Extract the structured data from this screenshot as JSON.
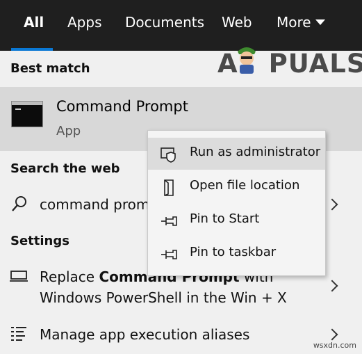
{
  "tabs": [
    {
      "label": "All",
      "active": true
    },
    {
      "label": "Apps"
    },
    {
      "label": "Documents"
    },
    {
      "label": "Web"
    },
    {
      "label": "More"
    }
  ],
  "best_match": {
    "section_title": "Best match",
    "title": "Command Prompt",
    "subtitle": "App"
  },
  "search_web": {
    "section_title": "Search the web",
    "query": "command prom"
  },
  "settings": {
    "section_title": "Settings",
    "item1_part1": "Replace ",
    "item1_bold": "Command Prompt",
    "item1_part2": " with",
    "item1_line2": "Windows PowerShell in the Win + X",
    "item2": "Manage app execution aliases"
  },
  "context_menu": {
    "items": [
      {
        "label": "Run as administrator",
        "icon": "shield-icon",
        "highlighted": true
      },
      {
        "label": "Open file location",
        "icon": "file-location-icon"
      },
      {
        "label": "Pin to Start",
        "icon": "pin-icon"
      },
      {
        "label": "Pin to taskbar",
        "icon": "pin-icon"
      }
    ]
  },
  "branding": {
    "logo_text": "A PUALS",
    "watermark": "wsxdn.com"
  },
  "colors": {
    "topbar_bg": "#1f1f1f",
    "accent": "#0a78d4",
    "selected_bg": "#d8d8d8",
    "panel_bg": "#f0f0f0"
  }
}
